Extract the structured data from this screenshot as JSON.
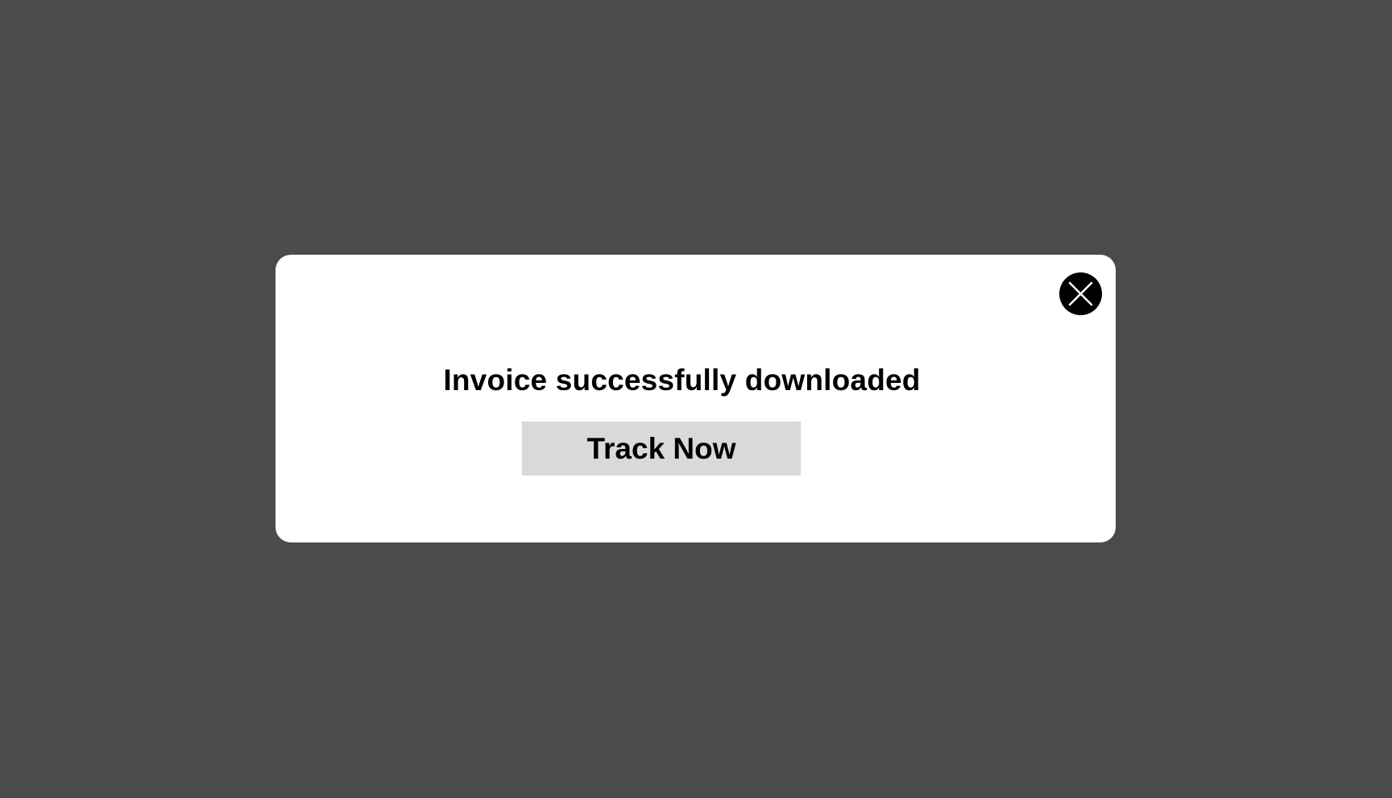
{
  "modal": {
    "title": "Invoice successfully downloaded",
    "primary_button_label": "Track Now",
    "close_icon": "close-icon"
  },
  "colors": {
    "backdrop": "#4b4b4b",
    "modal_background": "#ffffff",
    "close_button_background": "#000000",
    "primary_button_background": "#d9d9d9",
    "text": "#000000"
  }
}
